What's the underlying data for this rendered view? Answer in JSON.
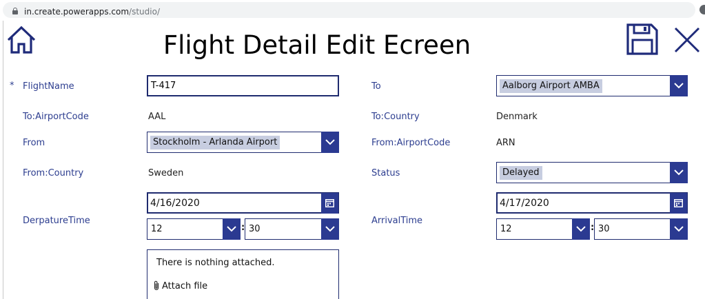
{
  "browser": {
    "url_host": "in.create.powerapps.com",
    "url_path": "/studio/"
  },
  "screen": {
    "title": "Flight Detail Edit Ecreen",
    "required_marker": "*"
  },
  "icons": {
    "home": "home-icon",
    "save": "save-icon",
    "close": "close-icon",
    "calendar": "calendar-icon",
    "chevron": "chevron-down-icon",
    "paperclip": "paperclip-icon"
  },
  "colors": {
    "accent": "#2b3a91",
    "label": "#2c3d8f",
    "selection": "#c7cde0"
  },
  "form": {
    "flight_name": {
      "label": "FlightName",
      "value": "T-417"
    },
    "to": {
      "label": "To",
      "value": "Aalborg Airport AMBA"
    },
    "to_airport_code": {
      "label": "To:AirportCode",
      "value": "AAL"
    },
    "to_country": {
      "label": "To:Country",
      "value": "Denmark"
    },
    "from": {
      "label": "From",
      "value": "Stockholm - Arlanda Airport"
    },
    "from_airport_code": {
      "label": "From:AirportCode",
      "value": "ARN"
    },
    "from_country": {
      "label": "From:Country",
      "value": "Sweden"
    },
    "status": {
      "label": "Status",
      "value": "Delayed"
    },
    "departure_time": {
      "label": "DerpatureTime",
      "date": "4/16/2020",
      "hour": "12",
      "minute": "30"
    },
    "arrival_time": {
      "label": "ArrivalTime",
      "date": "4/17/2020",
      "hour": "12",
      "minute": "30"
    },
    "time_separator": ":",
    "attachments": {
      "empty_message": "There is nothing attached.",
      "attach_label": "Attach file"
    }
  }
}
